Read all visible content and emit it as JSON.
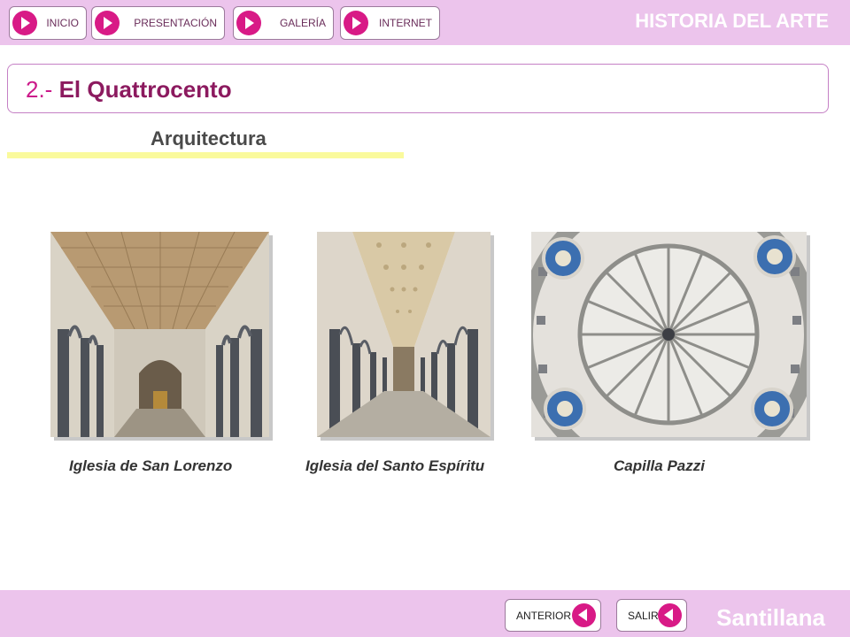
{
  "nav": [
    {
      "label": "INICIO"
    },
    {
      "label": "PRESENTACIÓN"
    },
    {
      "label": "GALERÍA"
    },
    {
      "label": "INTERNET"
    }
  ],
  "brand": "HISTORIA DEL ARTE",
  "title": {
    "number": "2.- ",
    "text": "El Quattrocento"
  },
  "section": "Arquitectura",
  "gallery": [
    {
      "caption": "Iglesia de San Lorenzo"
    },
    {
      "caption": "Iglesia del Santo Espíritu"
    },
    {
      "caption": "Capilla Pazzi"
    }
  ],
  "footer": {
    "prev_label": "ANTERIOR",
    "exit_label": "SALIR",
    "publisher": "Santillana"
  },
  "colors": {
    "bar": "#ecc4ec",
    "accent": "#d81a86",
    "title": "#cc1a8a",
    "underline": "#fafa9c"
  }
}
